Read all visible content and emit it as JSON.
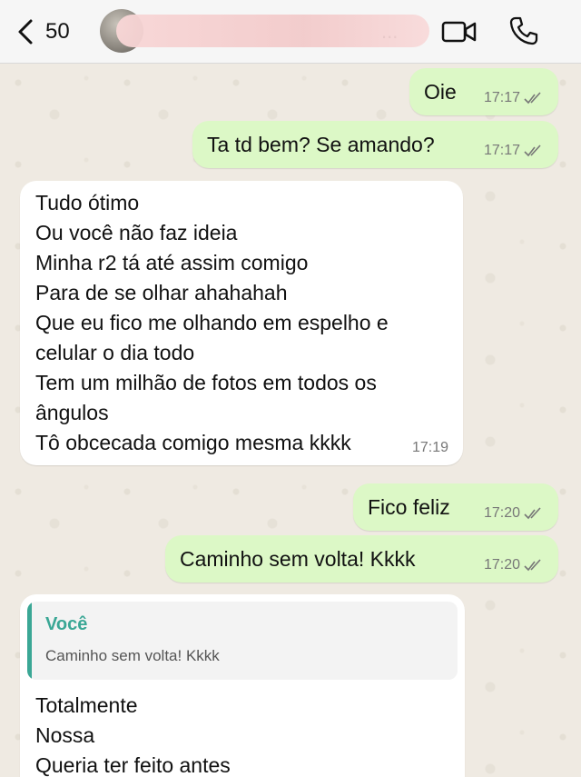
{
  "header": {
    "back_count": "50",
    "contact_name_visible": "...",
    "icons": [
      "chevron-left-icon",
      "video-call-icon",
      "phone-icon"
    ]
  },
  "messages": [
    {
      "direction": "outgoing",
      "text": "Oie",
      "time": "17:17",
      "status": "read"
    },
    {
      "direction": "outgoing",
      "text": "Ta td bem? Se amando?",
      "time": "17:17",
      "status": "read"
    },
    {
      "direction": "incoming",
      "text": "Tudo ótimo\nOu você não faz ideia\nMinha r2 tá até assim comigo\nPara de se olhar ahahahah\nQue eu fico me olhando em espelho e\ncelular o dia todo\nTem um milhão de fotos em todos os\nângulos\nTô obcecada comigo mesma kkkk",
      "time": "17:19"
    },
    {
      "direction": "outgoing",
      "text": "Fico feliz",
      "time": "17:20",
      "status": "read"
    },
    {
      "direction": "outgoing",
      "text": "Caminho sem volta! Kkkk",
      "time": "17:20",
      "status": "read"
    },
    {
      "direction": "incoming",
      "quote": {
        "author": "Você",
        "text": "Caminho sem volta! Kkkk"
      },
      "text": "Totalmente\nNossa\nQueria ter feito antes"
    }
  ],
  "colors": {
    "outgoing_bubble": "#dcf8c6",
    "incoming_bubble": "#ffffff",
    "quote_accent": "#3aa795",
    "chat_background": "#efeae2"
  }
}
